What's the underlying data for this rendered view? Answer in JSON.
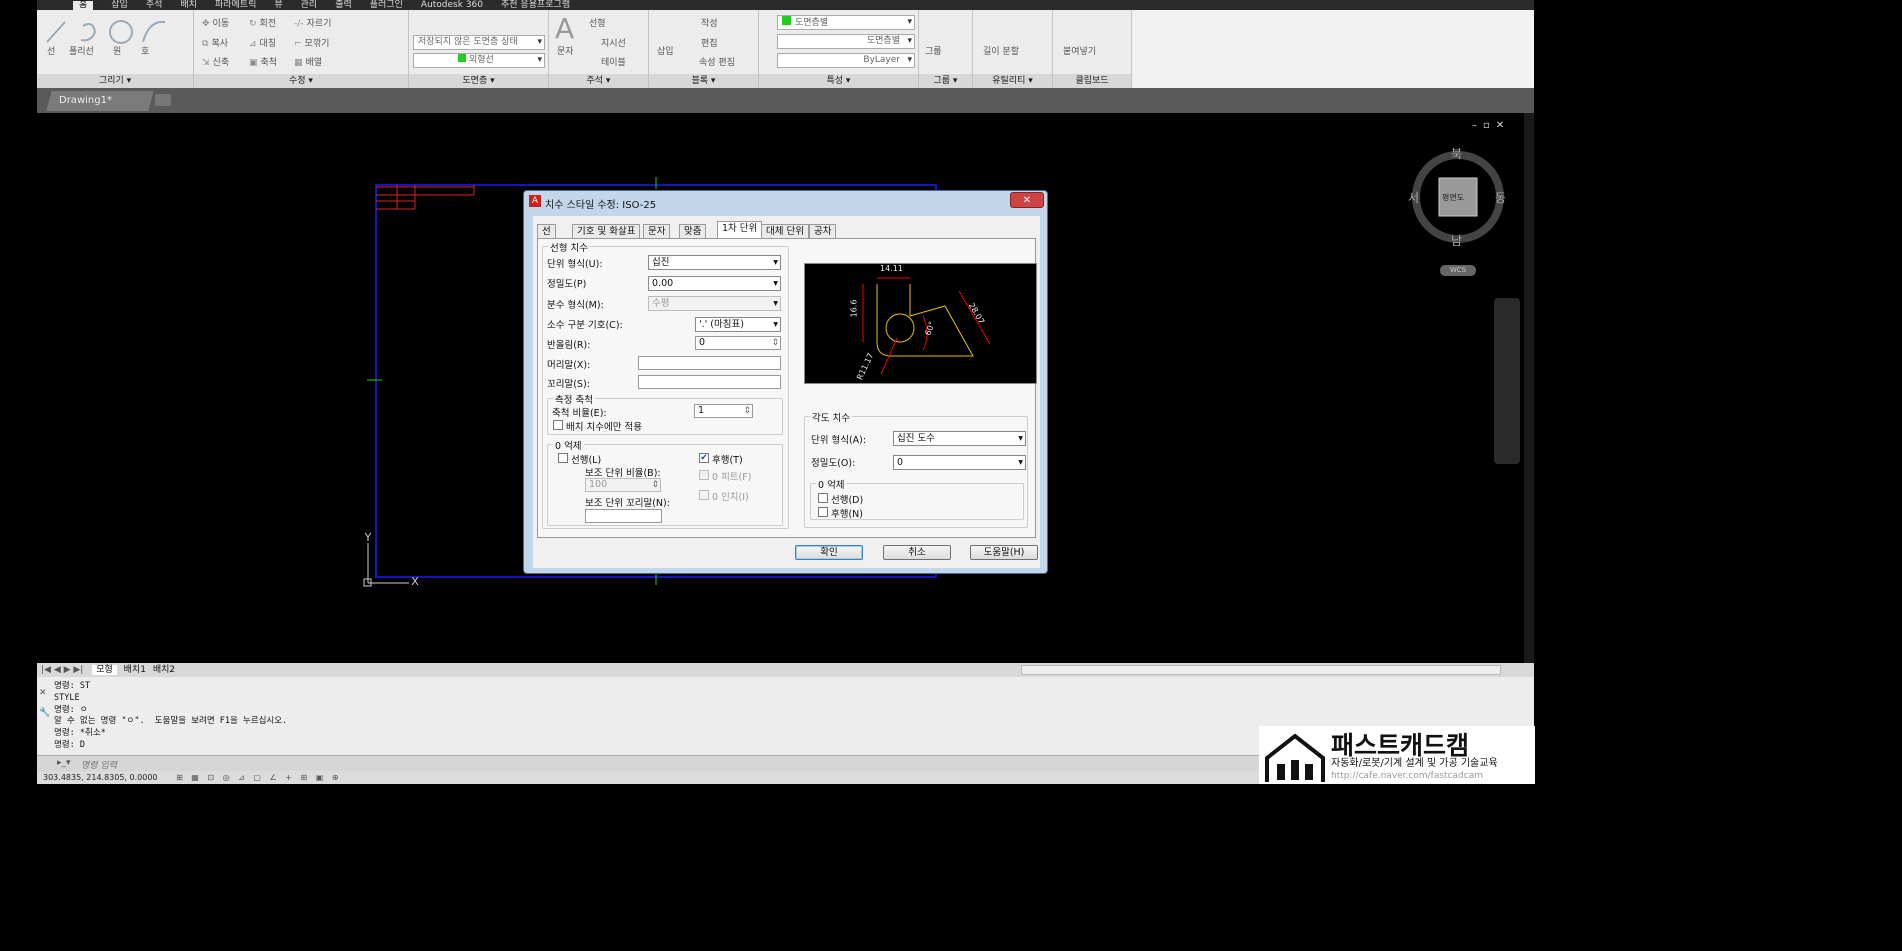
{
  "ribbon_tabs": [
    "홈",
    "삽입",
    "주석",
    "배치",
    "파라메트릭",
    "뷰",
    "관리",
    "출력",
    "플러그인",
    "Autodesk 360",
    "추천 응용프로그램"
  ],
  "panels": {
    "draw": {
      "title": "그리기 ▾",
      "tools": [
        "선",
        "폴리선",
        "원",
        "호"
      ]
    },
    "modify": {
      "title": "수정 ▾",
      "tools": [
        "이동",
        "회전",
        "자르기",
        "복사",
        "대칭",
        "모깎기",
        "신축",
        "축척",
        "배열"
      ]
    },
    "layers": {
      "title": "도면층 ▾",
      "layer_state": "저장되지 않은 도면층 상태",
      "current_layer": "외형선"
    },
    "annotation": {
      "title": "주석 ▾",
      "tools": [
        "문자",
        "선형",
        "지시선",
        "테이블"
      ]
    },
    "block": {
      "title": "블록 ▾",
      "tools": [
        "삽입",
        "작성",
        "편집",
        "속성 편집"
      ]
    },
    "properties": {
      "title": "특성 ▾",
      "color": "도면층별",
      "linetype": "도면층별",
      "lineweight": "ByLayer"
    },
    "groups": {
      "title": "그룹 ▾",
      "tool": "그룹"
    },
    "utilities": {
      "title": "유틸리티 ▾",
      "tool": "길이 분할"
    },
    "clipboard": {
      "title": "클립보드",
      "tool": "붙여넣기"
    }
  },
  "document_tab": "Drawing1*",
  "layout_tabs": [
    "모형",
    "배치1",
    "배치2"
  ],
  "viewcube": {
    "north": "북",
    "south": "남",
    "west": "서",
    "east": "동",
    "face": "평면도",
    "ucs": "WCS"
  },
  "dialog": {
    "title": "치수 스타일 수정: ISO-25",
    "close": "✕",
    "tabs": [
      "선",
      "기호 및 화살표",
      "문자",
      "맞춤",
      "1차 단위",
      "대체 단위",
      "공차"
    ],
    "linear": {
      "group": "선형 치수",
      "unit_format_label": "단위 형식(U):",
      "unit_format": "십진",
      "precision_label": "정밀도(P)",
      "precision": "0.00",
      "fraction_label": "분수 형식(M):",
      "fraction": "수평",
      "decimal_sep_label": "소수 구분 기호(C):",
      "decimal_sep": "'.' (마침표)",
      "round_label": "반올림(R):",
      "round": "0",
      "prefix_label": "머리말(X):",
      "prefix": "",
      "suffix_label": "꼬리말(S):",
      "suffix": ""
    },
    "scale": {
      "group": "측정 축척",
      "factor_label": "축척 비율(E):",
      "factor": "1",
      "layout_only": "배치 치수에만 적용"
    },
    "zero_supp": {
      "group": "0 억제",
      "leading": "선행(L)",
      "sub_factor_label": "보조 단위 비율(B):",
      "sub_factor": "100",
      "sub_suffix_label": "보조 단위 꼬리말(N):",
      "sub_suffix": "",
      "trailing": "후행(T)",
      "feet": "0 피트(F)",
      "inches": "0 인치(I)"
    },
    "angular": {
      "group": "각도 치수",
      "unit_format_label": "단위 형식(A):",
      "unit_format": "십진 도수",
      "precision_label": "정밀도(O):",
      "precision": "0",
      "zero_group": "0 억제",
      "leading": "선행(D)",
      "trailing": "후행(N)"
    },
    "preview_labels": {
      "top": "14.11",
      "left": "16.6",
      "right": "28.07",
      "angle": "60°",
      "radius": "R11.17"
    },
    "buttons": {
      "ok": "확인",
      "cancel": "취소",
      "help": "도움말(H)"
    }
  },
  "command_history": "명령: ST\nSTYLE\n명령: ㅇ\n알 수 없는 명령 \"ㅇ\".  도움말을 보려면 F1을 누르십시오.\n명령: *취소*\n명령: D",
  "command_prompt": "명령 입력",
  "coordinates": "303.4835, 214.8305, 0.0000",
  "watermark": {
    "brand": "패스트캐드캠",
    "tagline": "자동화/로봇/기계 설계 및 가공 기술교육",
    "url": "http://cafe.naver.com/fastcadcam"
  },
  "colors": {
    "accent_green": "#22cc22",
    "drawing_blue": "#1a1aff",
    "drawing_red": "#dd2222",
    "preview_yellow": "#e8c000"
  }
}
